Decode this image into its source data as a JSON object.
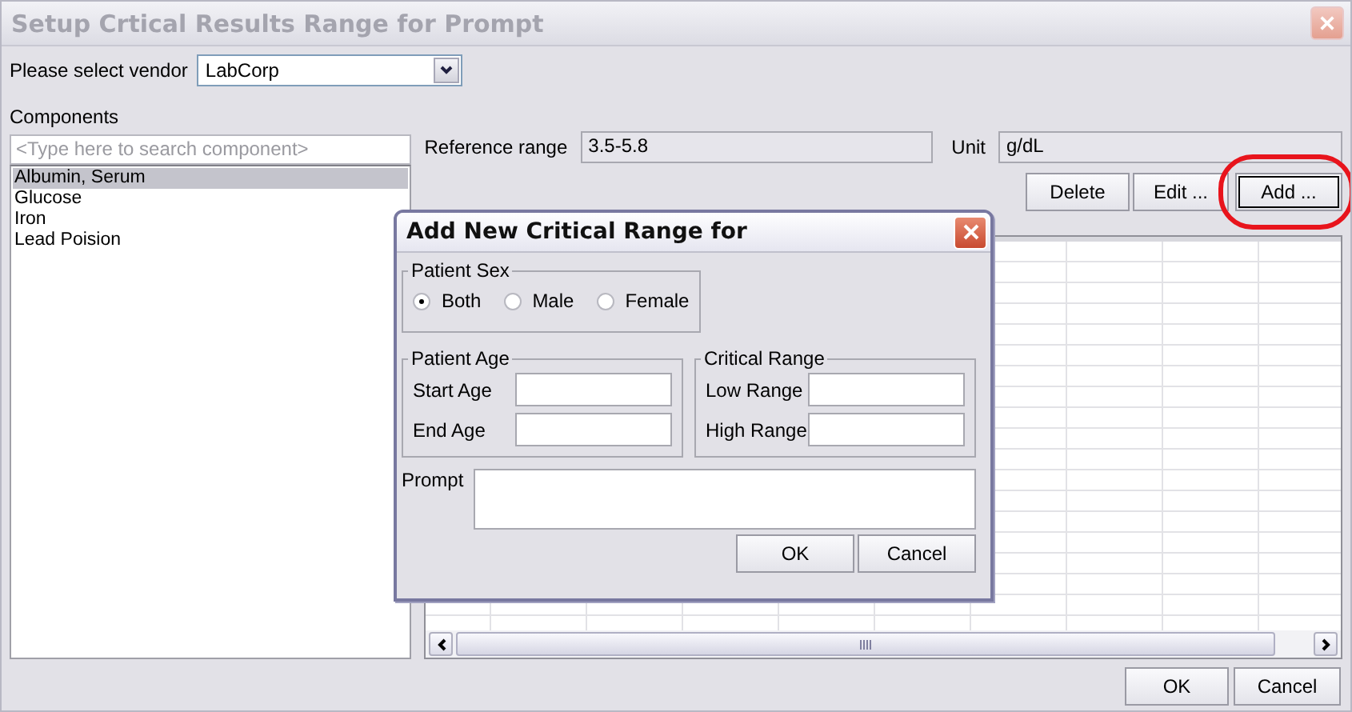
{
  "window": {
    "title": "Setup Crtical Results Range for Prompt"
  },
  "vendor": {
    "label": "Please select vendor",
    "value": "LabCorp"
  },
  "components": {
    "label": "Components",
    "placeholder": "<Type here to search component>",
    "items": [
      {
        "label": "Albumin, Serum",
        "selected": true
      },
      {
        "label": "Glucose",
        "selected": false
      },
      {
        "label": "Iron",
        "selected": false
      },
      {
        "label": "Lead Poision",
        "selected": false
      }
    ]
  },
  "reference_range": {
    "label": "Reference range",
    "value": "3.5-5.8"
  },
  "unit": {
    "label": "Unit",
    "value": "g/dL"
  },
  "actions": [
    {
      "label": "Delete",
      "highlighted": false
    },
    {
      "label": "Edit ...",
      "highlighted": false
    },
    {
      "label": "Add ...",
      "highlighted": true
    }
  ],
  "buttons": [
    "OK",
    "Cancel"
  ],
  "dialog": {
    "title": "Add New Critical Range for",
    "patient_sex": {
      "legend": "Patient Sex",
      "options": [
        {
          "label": "Both",
          "selected": true
        },
        {
          "label": "Male",
          "selected": false
        },
        {
          "label": "Female",
          "selected": false
        }
      ]
    },
    "patient_age": {
      "legend": "Patient Age",
      "fields": [
        "Start Age",
        "End Age"
      ]
    },
    "critical_range": {
      "legend": "Critical Range",
      "fields": [
        "Low Range",
        "High Range"
      ]
    },
    "prompt_label": "Prompt",
    "buttons": [
      "OK",
      "Cancel"
    ]
  }
}
